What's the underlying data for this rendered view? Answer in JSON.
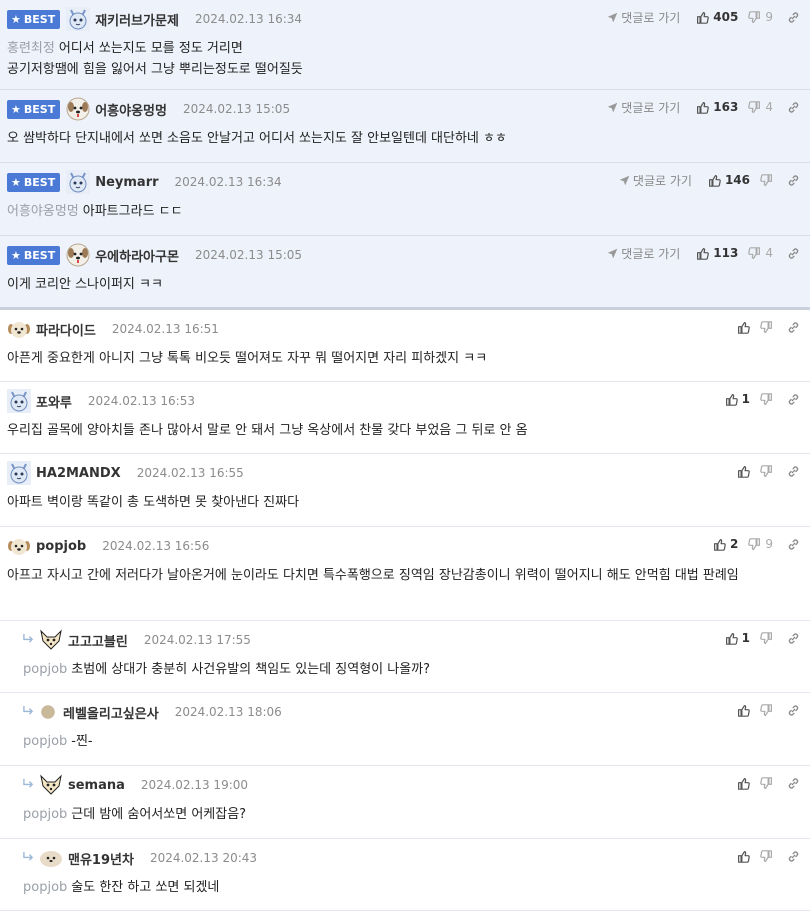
{
  "best_label": "BEST",
  "goto_label": "댓글로 가기",
  "comments": [
    {
      "best": true,
      "nick": "재키러브가문제",
      "date": "2024.02.13 16:34",
      "mention": "홍련최정",
      "text": "어디서 쏘는지도 모를 정도 거리면\n공기저항땜에 힘을 잃어서 그냥 뿌리는정도로 떨어질듯",
      "up": "405",
      "down": "9",
      "avatar": "rabbit"
    },
    {
      "best": true,
      "nick": "어흥야옹멍멍",
      "date": "2024.02.13 15:05",
      "mention": "",
      "text": "오 쌈박하다 단지내에서 쏘면 소음도 안날거고 어디서 쏘는지도 잘 안보일텐데 대단하네 ㅎㅎ",
      "up": "163",
      "down": "4",
      "avatar": "dog"
    },
    {
      "best": true,
      "nick": "Neymarr",
      "date": "2024.02.13 16:34",
      "mention": "어흥야옹멍멍",
      "text": "아파트그라드 ㄷㄷ",
      "up": "146",
      "down": "",
      "avatar": "rabbit2"
    },
    {
      "best": true,
      "nick": "우에하라아구몬",
      "date": "2024.02.13 15:05",
      "mention": "",
      "text": "이게 코리안 스나이퍼지 ㅋㅋ",
      "up": "113",
      "down": "4",
      "avatar": "dog"
    },
    {
      "best": false,
      "nick": "파라다이드",
      "date": "2024.02.13 16:51",
      "mention": "",
      "text": "아픈게 중요한게 아니지 그냥 톡톡 비오듯 떨어져도 자꾸 뭐 떨어지면 자리 피하겠지 ㅋㅋ",
      "up": "",
      "down": "",
      "avatar": "puppy"
    },
    {
      "best": false,
      "nick": "포와루",
      "date": "2024.02.13 16:53",
      "mention": "",
      "text": "우리집 골목에 양아치들 존나 많아서 말로 안 돼서 그냥 옥상에서 찬물 갖다 부었음 그 뒤로 안 옴",
      "up": "1",
      "down": "",
      "avatar": "rabbit"
    },
    {
      "best": false,
      "nick": "HA2MANDX",
      "date": "2024.02.13 16:55",
      "mention": "",
      "text": "아파트 벽이랑 똑같이 총 도색하면 못 찾아낸다 진짜다",
      "up": "",
      "down": "",
      "avatar": "rabbit2"
    },
    {
      "best": false,
      "nick": "popjob",
      "date": "2024.02.13 16:56",
      "mention": "",
      "text": "아프고 자시고 간에 저러다가 날아온거에 눈이라도 다치면 특수폭행으로 징역임 장난감총이니 위력이 떨어지니 해도 안먹힘 대법 판례임",
      "up": "2",
      "down": "9",
      "avatar": "puppy"
    },
    {
      "best": false,
      "reply": true,
      "nick": "고고고블린",
      "date": "2024.02.13 17:55",
      "mention": "popjob",
      "text": "초범에 상대가 충분히 사건유발의 책임도 있는데 징역형이 나올까?",
      "up": "1",
      "down": "",
      "avatar": "fox"
    },
    {
      "best": false,
      "reply": true,
      "nick": "레벨올리고싶은사",
      "date": "2024.02.13 18:06",
      "mention": "popjob",
      "text": "-찐-",
      "up": "",
      "down": "",
      "avatar": "dot"
    },
    {
      "best": false,
      "reply": true,
      "nick": "semana",
      "date": "2024.02.13 19:00",
      "mention": "popjob",
      "text": "근데 밤에 숨어서쏘면 어케잡음?",
      "up": "",
      "down": "",
      "avatar": "fox"
    },
    {
      "best": false,
      "reply": true,
      "nick": "맨유19년차",
      "date": "2024.02.13 20:43",
      "mention": "popjob",
      "text": "술도 한잔 하고 쏘면 되겠네",
      "up": "",
      "down": "",
      "avatar": "puppy2"
    }
  ]
}
